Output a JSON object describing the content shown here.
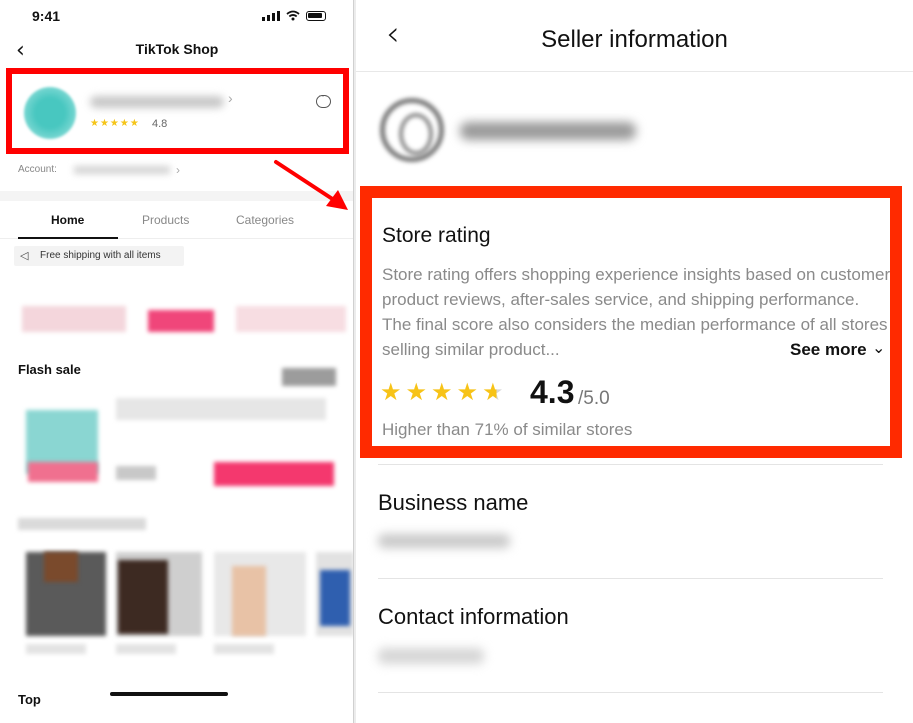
{
  "left_screen": {
    "status_time": "9:41",
    "nav_title": "TikTok Shop",
    "store": {
      "rating": "4.8",
      "stars_icon": "star-rating-icon",
      "rating_fraction": 0.96
    },
    "account_label": "Account:",
    "tabs": [
      {
        "label": "Home",
        "active": true
      },
      {
        "label": "Products",
        "active": false
      },
      {
        "label": "Categories",
        "active": false
      }
    ],
    "shipping_chip": "Free shipping with all items",
    "flash_sale_label": "Flash sale",
    "top_label": "Top"
  },
  "right_screen": {
    "nav_title": "Seller information",
    "store_rating": {
      "title": "Store rating",
      "description": "Store rating offers shopping experience insights based on customer product reviews, after-sales service, and shipping performance. The final score also considers the median performance of all stores selling similar product...",
      "see_more": "See more",
      "score": "4.3",
      "max": "/5.0",
      "rating_fraction": 0.86,
      "comparison": "Higher than 71% of similar stores"
    },
    "business_name_title": "Business name",
    "contact_title": "Contact information"
  },
  "colors": {
    "highlight_red": "#ff0000",
    "star_yellow": "#f7c317",
    "text_primary": "#111111",
    "text_secondary": "#8a8a8a"
  }
}
